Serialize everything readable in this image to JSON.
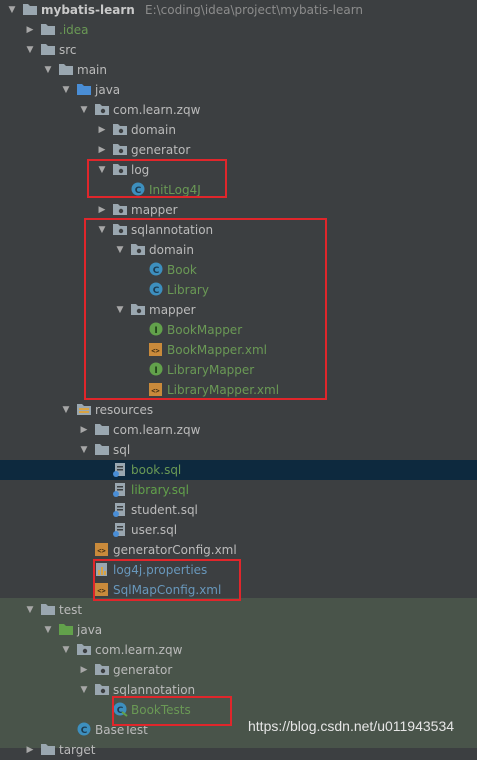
{
  "project": {
    "name": "mybatis-learn",
    "path": "E:\\coding\\idea\\project\\mybatis-learn"
  },
  "tree": [
    {
      "label": "mybatis-learn",
      "arrow": "down",
      "icon": "folder-icon",
      "depth": 0,
      "kind": "root"
    },
    {
      "label": ".idea",
      "arrow": "right",
      "icon": "folder-icon",
      "depth": 1,
      "color": "green"
    },
    {
      "label": "src",
      "arrow": "down",
      "icon": "folder-icon",
      "depth": 1
    },
    {
      "label": "main",
      "arrow": "down",
      "icon": "folder-icon",
      "depth": 2
    },
    {
      "label": "java",
      "arrow": "down",
      "icon": "source-folder-icon",
      "depth": 3
    },
    {
      "label": "com.learn.zqw",
      "arrow": "down",
      "icon": "package-icon",
      "depth": 4
    },
    {
      "label": "domain",
      "arrow": "right",
      "icon": "package-icon",
      "depth": 5
    },
    {
      "label": "generator",
      "arrow": "right",
      "icon": "package-icon",
      "depth": 5
    },
    {
      "label": "log",
      "arrow": "down",
      "icon": "package-icon",
      "depth": 5
    },
    {
      "label": "InitLog4J",
      "arrow": "",
      "icon": "class-icon",
      "depth": 6,
      "color": "green"
    },
    {
      "label": "mapper",
      "arrow": "right",
      "icon": "package-icon",
      "depth": 5
    },
    {
      "label": "sqlannotation",
      "arrow": "down",
      "icon": "package-icon",
      "depth": 5
    },
    {
      "label": "domain",
      "arrow": "down",
      "icon": "package-icon",
      "depth": 6
    },
    {
      "label": "Book",
      "arrow": "",
      "icon": "class-icon",
      "depth": 7,
      "color": "green"
    },
    {
      "label": "Library",
      "arrow": "",
      "icon": "class-icon",
      "depth": 7,
      "color": "green"
    },
    {
      "label": "mapper",
      "arrow": "down",
      "icon": "package-icon",
      "depth": 6
    },
    {
      "label": "BookMapper",
      "arrow": "",
      "icon": "interface-icon",
      "depth": 7,
      "color": "green"
    },
    {
      "label": "BookMapper.xml",
      "arrow": "",
      "icon": "xml-icon",
      "depth": 7,
      "color": "green"
    },
    {
      "label": "LibraryMapper",
      "arrow": "",
      "icon": "interface-icon",
      "depth": 7,
      "color": "green"
    },
    {
      "label": "LibraryMapper.xml",
      "arrow": "",
      "icon": "xml-icon",
      "depth": 7,
      "color": "green"
    },
    {
      "label": "resources",
      "arrow": "down",
      "icon": "resources-folder-icon",
      "depth": 3
    },
    {
      "label": "com.learn.zqw",
      "arrow": "right",
      "icon": "folder-icon",
      "depth": 4
    },
    {
      "label": "sql",
      "arrow": "down",
      "icon": "folder-icon",
      "depth": 4
    },
    {
      "label": "book.sql",
      "arrow": "",
      "icon": "sql-file-icon",
      "depth": 5,
      "color": "green",
      "selected": true
    },
    {
      "label": "library.sql",
      "arrow": "",
      "icon": "sql-file-icon",
      "depth": 5,
      "color": "green2"
    },
    {
      "label": "student.sql",
      "arrow": "",
      "icon": "sql-file-icon",
      "depth": 5
    },
    {
      "label": "user.sql",
      "arrow": "",
      "icon": "sql-file-icon",
      "depth": 5
    },
    {
      "label": "generatorConfig.xml",
      "arrow": "",
      "icon": "xml-icon",
      "depth": 4
    },
    {
      "label": "log4j.properties",
      "arrow": "",
      "icon": "properties-icon",
      "depth": 4,
      "color": "blue"
    },
    {
      "label": "SqlMapConfig.xml",
      "arrow": "",
      "icon": "xml-icon",
      "depth": 4,
      "color": "blue"
    },
    {
      "label": "test",
      "arrow": "down",
      "icon": "folder-icon",
      "depth": 1
    },
    {
      "label": "java",
      "arrow": "down",
      "icon": "test-source-folder-icon",
      "depth": 2
    },
    {
      "label": "com.learn.zqw",
      "arrow": "down",
      "icon": "package-icon",
      "depth": 3
    },
    {
      "label": "generator",
      "arrow": "right",
      "icon": "package-icon",
      "depth": 4
    },
    {
      "label": "sqlannotation",
      "arrow": "down",
      "icon": "package-icon",
      "depth": 4
    },
    {
      "label": "BookTests",
      "arrow": "",
      "icon": "test-class-icon",
      "depth": 5,
      "color": "green"
    },
    {
      "label": "BaseTest",
      "arrow": "",
      "icon": "class-icon",
      "depth": 3
    },
    {
      "label": "target",
      "arrow": "right",
      "icon": "folder-icon",
      "depth": 1
    }
  ],
  "watermark": "https://blog.csdn.net/u011943534",
  "colors": {
    "background": "#3c3f41",
    "selected": "#0d293e",
    "highlight_box": "#e0262b",
    "test_area": "#49544a"
  }
}
